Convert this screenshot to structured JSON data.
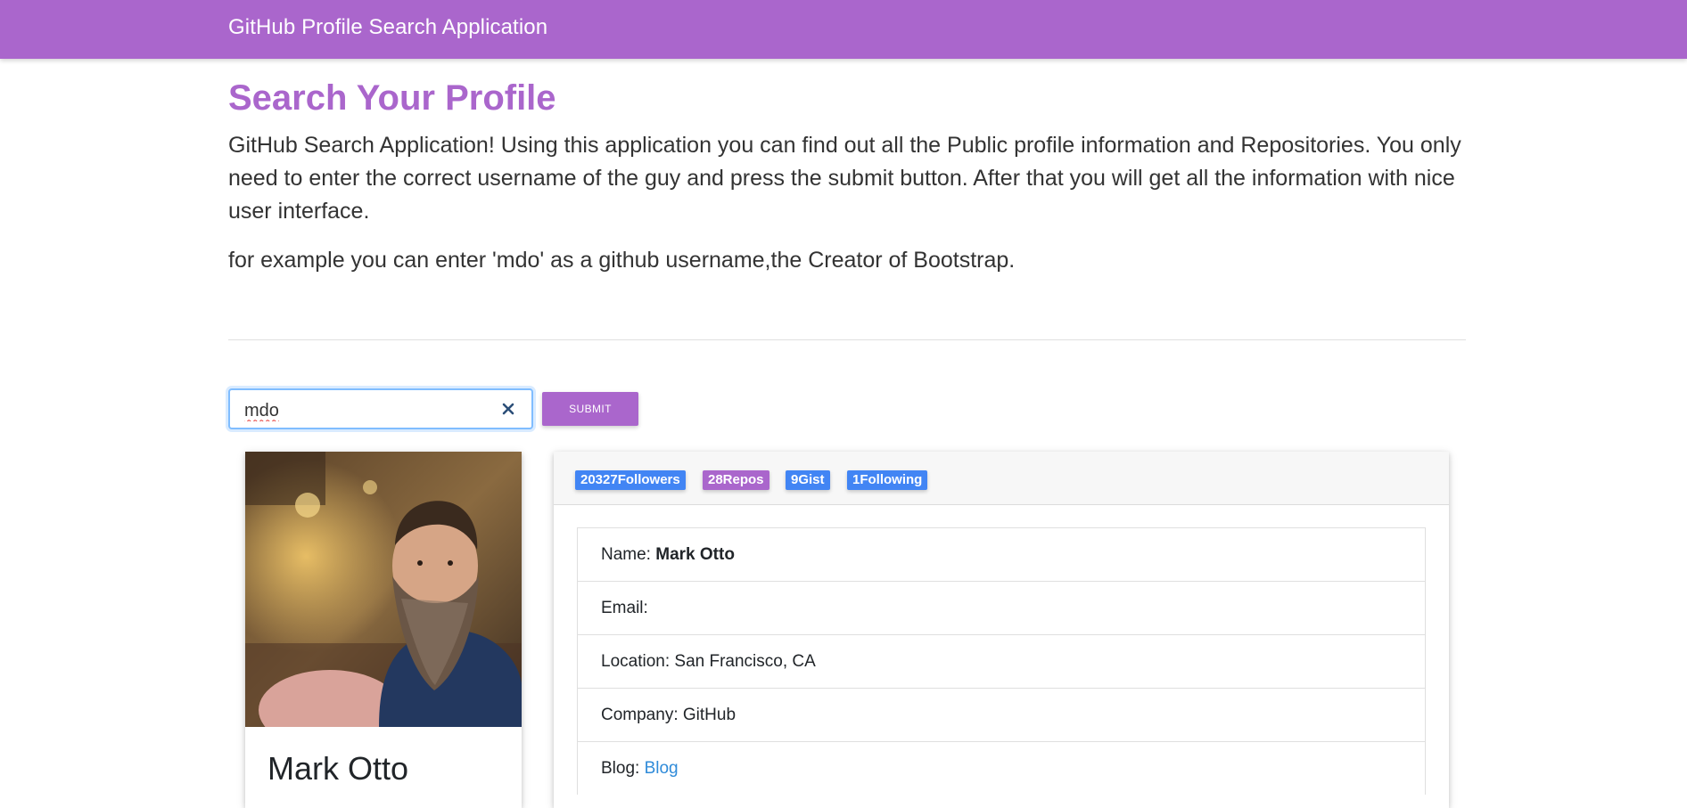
{
  "navbar": {
    "brand": "GitHub Profile Search Application"
  },
  "intro": {
    "heading": "Search Your Profile",
    "lead": "GitHub Search Application! Using this application you can find out all the Public profile information and Repositories. You only need to enter the correct username of the guy and press the submit button. After that you will get all the information with nice user interface.",
    "example": "for example you can enter 'mdo' as a github username,the Creator of Bootstrap."
  },
  "search": {
    "value": "mdo",
    "clear_icon": "close-x-icon",
    "submit_label": "SUBMIT"
  },
  "profile": {
    "name": "Mark Otto",
    "avatar": "user-photo"
  },
  "badges": {
    "followers": "20327Followers",
    "repos": "28Repos",
    "gist": "9Gist",
    "following": "1Following"
  },
  "details": {
    "name_label": "Name: ",
    "name_value": "Mark Otto",
    "email_label": "Email:",
    "location_label": "Location: ",
    "location_value": "San Francisco, CA",
    "company_label": "Company: ",
    "company_value": "GitHub",
    "blog_label": "Blog: ",
    "blog_link": "Blog"
  },
  "colors": {
    "primary": "#aa66cc",
    "badge_blue": "#4285f4",
    "badge_purple": "#aa66cc",
    "link": "#2f8bd9"
  }
}
